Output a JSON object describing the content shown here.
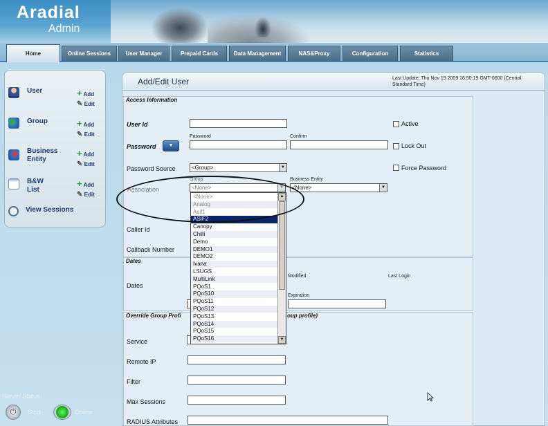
{
  "app": {
    "logo_title": "Aradial",
    "logo_subtitle": "Admin"
  },
  "tabs": [
    {
      "label": "Home",
      "active": true
    },
    {
      "label": "Online Sessions"
    },
    {
      "label": "User Manager"
    },
    {
      "label": "Prepaid Cards"
    },
    {
      "label": "Data Management"
    },
    {
      "label": "NAS&Proxy"
    },
    {
      "label": "Configuration"
    },
    {
      "label": "Statistics"
    }
  ],
  "sidebar": {
    "items": [
      {
        "label": "User",
        "add": "Add",
        "edit": "Edit",
        "icon": "user-icon"
      },
      {
        "label": "Group",
        "add": "Add",
        "edit": "Edit",
        "icon": "group-icon"
      },
      {
        "label": "Business Entity",
        "add": "Add",
        "edit": "Edit",
        "icon": "business-entity-icon"
      },
      {
        "label": "B&W List",
        "add": "Add",
        "edit": "Edit",
        "icon": "bw-list-icon"
      }
    ],
    "view_sessions": "View Sessions"
  },
  "server_status": {
    "label": "Server Status",
    "stop_label": "Stop",
    "online_label": "Online"
  },
  "page": {
    "title": "Add/Edit User",
    "last_update": "Last Update: Thu Nov 19 2009 16:50:19 GMT-0600 (Central Standard Time)"
  },
  "access": {
    "section_title": "Access Information",
    "user_id_label": "User Id",
    "user_id_value": "",
    "password_label": "Password",
    "password_sub_label": "Password",
    "confirm_sub_label": "Confirm",
    "pw_button_icon": "chevron-down-icon",
    "active_label": "Active",
    "lock_out_label": "Lock Out",
    "force_password_label": "Force Password",
    "password_source_label": "Password Source",
    "password_source_value": "<Group>",
    "association_label": "Association",
    "group_sub_label": "Group",
    "group_value": "<None>",
    "business_entity_sub_label": "Business Entity",
    "business_entity_value": "<None>",
    "caller_id_label": "Caller Id",
    "callback_number_label": "Callback Number"
  },
  "group_options": [
    {
      "label": "<None>",
      "state": "grey"
    },
    {
      "label": "Analog",
      "state": "grey"
    },
    {
      "label": "Asif1",
      "state": "grey"
    },
    {
      "label": "ASIF2",
      "state": "selected"
    },
    {
      "label": "Canopy"
    },
    {
      "label": "Chilli"
    },
    {
      "label": "Demo"
    },
    {
      "label": "DEMO1"
    },
    {
      "label": "DEMO2"
    },
    {
      "label": "Ivana"
    },
    {
      "label": "LSUGS"
    },
    {
      "label": "MultiLink"
    },
    {
      "label": "PQoS1"
    },
    {
      "label": "PQoS10"
    },
    {
      "label": "PQoS11"
    },
    {
      "label": "PQoS12"
    },
    {
      "label": "PQoS13"
    },
    {
      "label": "PQoS14"
    },
    {
      "label": "PQoS15"
    },
    {
      "label": "PQoS16"
    }
  ],
  "dates": {
    "section_title": "Dates",
    "dates_label": "Dates",
    "modified_label": "Modified",
    "last_login_label": "Last Login",
    "expiration_label": "Expiration"
  },
  "override": {
    "section_title": "Override Group Profi",
    "section_title_tail": "oup profile)",
    "service_label": "Service",
    "remote_ip_label": "Remote IP",
    "filter_label": "Filter",
    "max_sessions_label": "Max Sessions",
    "radius_attributes_label": "RADIUS Attributes"
  }
}
